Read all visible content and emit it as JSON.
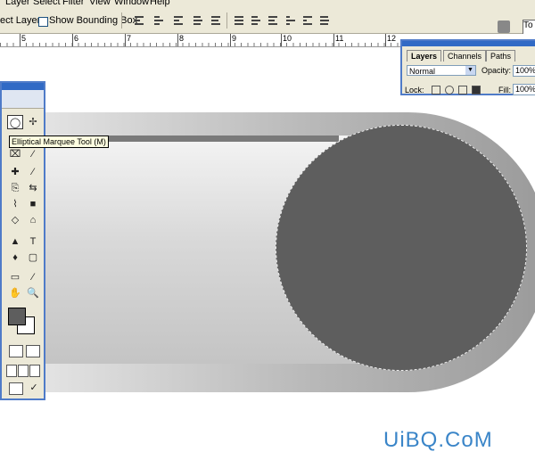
{
  "menu": [
    "Layer",
    "Select",
    "Filter",
    "View",
    "Window",
    "Help"
  ],
  "options": {
    "auto_select_fragment": "ect Layer",
    "bounding_box_label": "Show Bounding Box",
    "right_button_fragment": "To"
  },
  "ruler": {
    "numbers": [
      "5",
      "6",
      "7",
      "8",
      "9",
      "10",
      "11",
      "12"
    ]
  },
  "tooltip": "Elliptical Marquee Tool (M)",
  "layers_panel": {
    "tabs": [
      "Layers",
      "Channels",
      "Paths"
    ],
    "blend_mode": "Normal",
    "opacity_label": "Opacity:",
    "opacity_value": "100%",
    "lock_label": "Lock:",
    "fill_label": "Fill:",
    "fill_value": "100%"
  },
  "tools": [
    "◯",
    "✢",
    "⌗",
    "✦",
    "⌧",
    "⁄",
    "✚",
    "⁄",
    "⎘",
    "⇆",
    "⌇",
    "■",
    "◇",
    "⌂",
    "▲",
    "T",
    "♦",
    "▢",
    "▭",
    "⁄",
    "✋",
    "🔍"
  ],
  "colors": {
    "foreground": "#5e5e5e",
    "background": "#ffffff",
    "accent": "#316ac5"
  },
  "watermark": "UiBQ.CoM"
}
